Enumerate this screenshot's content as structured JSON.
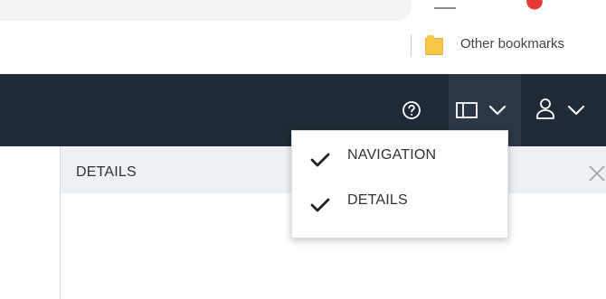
{
  "browser": {
    "bookmarks_bar": {
      "folder_label": "Other bookmarks"
    }
  },
  "app_header": {
    "help_icon": "help-circle-icon",
    "panel_toggle_icon": "panel-layout-icon",
    "user_icon": "user-icon"
  },
  "details_panel": {
    "title": "DETAILS"
  },
  "panel_menu": {
    "items": [
      {
        "label": "NAVIGATION",
        "checked": true
      },
      {
        "label": "DETAILS",
        "checked": true
      }
    ]
  },
  "colors": {
    "header_bg": "#1f2a36",
    "panel_header_bg": "#edf1f4",
    "menu_bg": "#ffffff",
    "folder_yellow": "#f8c84b"
  }
}
